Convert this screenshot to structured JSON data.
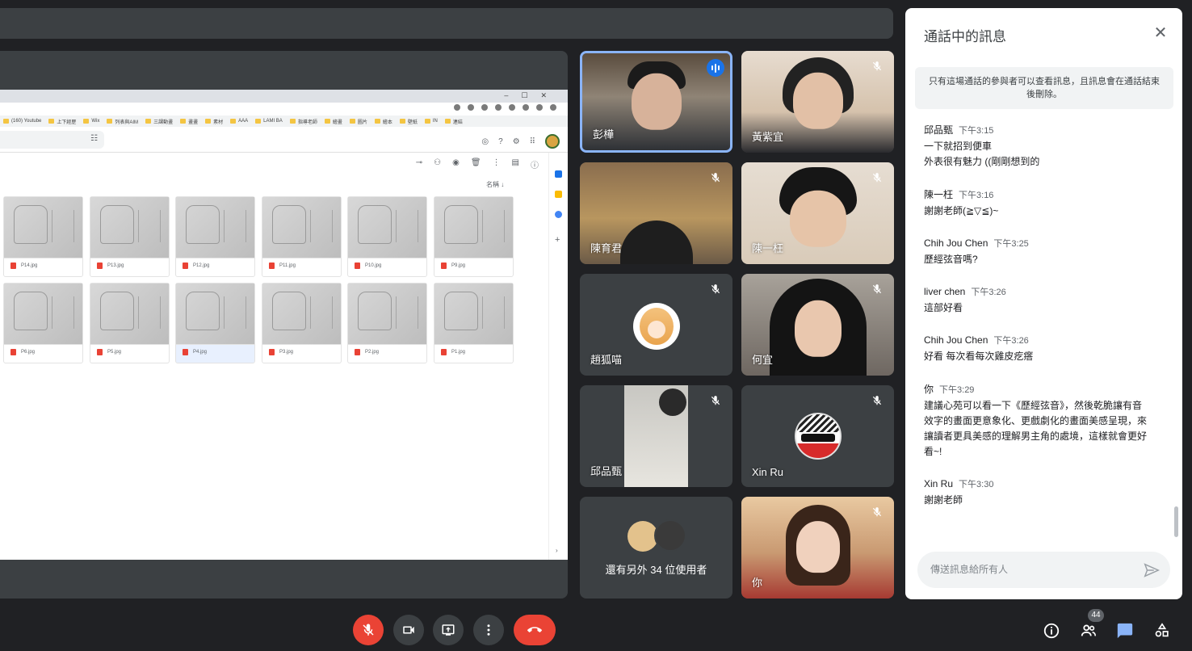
{
  "shared_screen": {
    "chrome_window_controls": [
      "–",
      "☐",
      "✕"
    ],
    "bookmarks": [
      "(160) Youtube",
      "上下經歷",
      "Wix",
      "列表與AIM",
      "三課動畫",
      "畫畫",
      "素材",
      "AAA",
      "LAMI BA",
      "指導老師",
      "繪畫",
      "圖片",
      "繪本",
      "壁紙",
      "IN",
      "連結"
    ],
    "sort_label": "名稱",
    "files_row1": [
      "P14.jpg",
      "P13.jpg",
      "P12.jpg",
      "P11.jpg",
      "P10.jpg",
      "P9.jpg"
    ],
    "files_row2": [
      "P6.jpg",
      "P5.jpg",
      "P4.jpg",
      "P3.jpg",
      "P2.jpg",
      "P1.jpg"
    ],
    "selected_file": "P4.jpg"
  },
  "participants": [
    {
      "name": "彭樺",
      "muted": false,
      "speaking": true
    },
    {
      "name": "黃紫宜",
      "muted": true
    },
    {
      "name": "陳育君",
      "muted": true
    },
    {
      "name": "陳一枉",
      "muted": true
    },
    {
      "name": "趙狐喵",
      "muted": true
    },
    {
      "name": "何宜",
      "muted": true
    },
    {
      "name": "邱品甄",
      "muted": true
    },
    {
      "name": "Xin Ru",
      "muted": true
    },
    {
      "name": "還有另外 34 位使用者"
    },
    {
      "name": "你",
      "muted": true
    }
  ],
  "chat": {
    "title": "通話中的訊息",
    "notice": "只有這場通話的參與者可以查看訊息，且訊息會在通話結束後刪除。",
    "messages": [
      {
        "sender": "邱品甄",
        "time": "下午3:15",
        "lines": [
          "一下就招到便車",
          "外表很有魅力 ((剛剛想到的"
        ]
      },
      {
        "sender": "陳一枉",
        "time": "下午3:16",
        "lines": [
          "謝謝老師(≧▽≦)~"
        ]
      },
      {
        "sender": "Chih Jou Chen",
        "time": "下午3:25",
        "lines": [
          "歷經弦音嗎?"
        ]
      },
      {
        "sender": "liver chen",
        "time": "下午3:26",
        "lines": [
          "這部好看"
        ]
      },
      {
        "sender": "Chih Jou Chen",
        "time": "下午3:26",
        "lines": [
          "好看 每次看每次雞皮疙瘩"
        ]
      },
      {
        "sender": "你",
        "time": "下午3:29",
        "lines": [
          "建議心苑可以看一下《歷經弦音》，然後乾脆讓有音",
          "效字的畫面更意象化、更戲劇化的畫面美感呈現，來",
          "讓讀者更具美感的理解男主角的處境，這樣就會更好",
          "看~!"
        ]
      },
      {
        "sender": "Xin Ru",
        "time": "下午3:30",
        "lines": [
          "謝謝老師"
        ]
      }
    ],
    "input_placeholder": "傳送訊息給所有人"
  },
  "controls": {
    "participants_count": "44",
    "mic_color": "#ea4335",
    "hangup_color": "#ea4335",
    "chat_active_color": "#8ab4f8"
  }
}
